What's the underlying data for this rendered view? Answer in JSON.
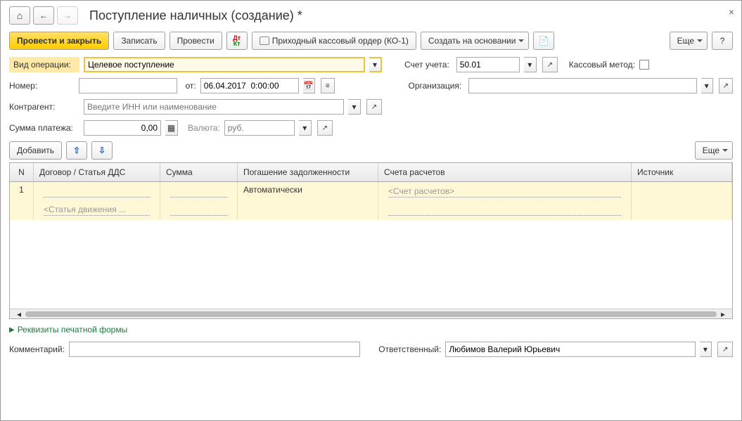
{
  "titlebar": {
    "title": "Поступление наличных (создание) *"
  },
  "toolbar": {
    "postAndClose": "Провести и закрыть",
    "save": "Записать",
    "post": "Провести",
    "printOrder": "Приходный кассовый ордер (КО-1)",
    "createBasedOn": "Создать на основании",
    "more": "Еще",
    "help": "?"
  },
  "fields": {
    "operationType": {
      "label": "Вид операции:",
      "value": "Целевое поступление"
    },
    "account": {
      "label": "Счет учета:",
      "value": "50.01"
    },
    "cashMethod": {
      "label": "Кассовый метод:"
    },
    "number": {
      "label": "Номер:",
      "value": ""
    },
    "dateFrom": {
      "label": "от:",
      "value": "06.04.2017  0:00:00"
    },
    "organization": {
      "label": "Организация:",
      "value": ""
    },
    "counterparty": {
      "label": "Контрагент:",
      "placeholder": "Введите ИНН или наименование"
    },
    "paymentAmount": {
      "label": "Сумма платежа:",
      "value": "0,00"
    },
    "currency": {
      "label": "Валюта:",
      "placeholder": "руб."
    }
  },
  "tableToolbar": {
    "add": "Добавить",
    "more": "Еще"
  },
  "table": {
    "headers": {
      "n": "N",
      "dogovor": "Договор / Статья ДДС",
      "summa": "Сумма",
      "pogashenie": "Погашение задолженности",
      "schet": "Счета расчетов",
      "istochnik": "Источник"
    },
    "rows": [
      {
        "n": "1",
        "dogovor": "",
        "dds": "<Статья движения ...",
        "summa": "",
        "pogashenie": "Автоматически",
        "schet": "<Счет расчетов>",
        "istochnik": ""
      }
    ]
  },
  "link": {
    "label": "Реквизиты печатной формы"
  },
  "bottom": {
    "comment": {
      "label": "Комментарий:",
      "value": ""
    },
    "responsible": {
      "label": "Ответственный:",
      "value": "Любимов Валерий Юрьевич"
    }
  }
}
